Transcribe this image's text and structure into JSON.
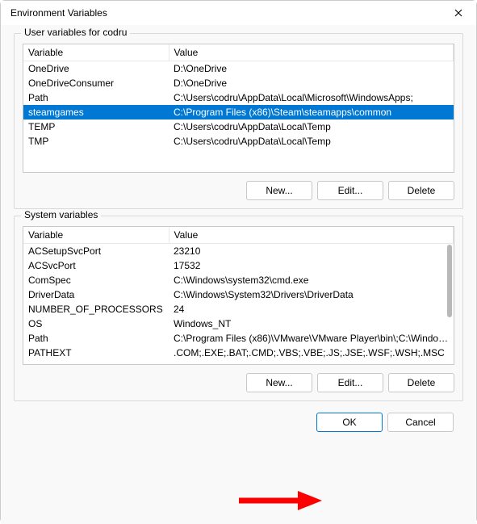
{
  "window": {
    "title": "Environment Variables"
  },
  "user_section": {
    "label": "User variables for codru",
    "columns": {
      "var": "Variable",
      "val": "Value"
    },
    "rows": [
      {
        "var": "OneDrive",
        "val": "D:\\OneDrive"
      },
      {
        "var": "OneDriveConsumer",
        "val": "D:\\OneDrive"
      },
      {
        "var": "Path",
        "val": "C:\\Users\\codru\\AppData\\Local\\Microsoft\\WindowsApps;"
      },
      {
        "var": "steamgames",
        "val": "C:\\Program Files (x86)\\Steam\\steamapps\\common"
      },
      {
        "var": "TEMP",
        "val": "C:\\Users\\codru\\AppData\\Local\\Temp"
      },
      {
        "var": "TMP",
        "val": "C:\\Users\\codru\\AppData\\Local\\Temp"
      }
    ],
    "selected_index": 3,
    "buttons": {
      "new": "New...",
      "edit": "Edit...",
      "delete": "Delete"
    }
  },
  "system_section": {
    "label": "System variables",
    "columns": {
      "var": "Variable",
      "val": "Value"
    },
    "rows": [
      {
        "var": "ACSetupSvcPort",
        "val": "23210"
      },
      {
        "var": "ACSvcPort",
        "val": "17532"
      },
      {
        "var": "ComSpec",
        "val": "C:\\Windows\\system32\\cmd.exe"
      },
      {
        "var": "DriverData",
        "val": "C:\\Windows\\System32\\Drivers\\DriverData"
      },
      {
        "var": "NUMBER_OF_PROCESSORS",
        "val": "24"
      },
      {
        "var": "OS",
        "val": "Windows_NT"
      },
      {
        "var": "Path",
        "val": "C:\\Program Files (x86)\\VMware\\VMware Player\\bin\\;C:\\Windows\\..."
      },
      {
        "var": "PATHEXT",
        "val": ".COM;.EXE;.BAT;.CMD;.VBS;.VBE;.JS;.JSE;.WSF;.WSH;.MSC"
      }
    ],
    "buttons": {
      "new": "New...",
      "edit": "Edit...",
      "delete": "Delete"
    }
  },
  "dialog_buttons": {
    "ok": "OK",
    "cancel": "Cancel"
  }
}
